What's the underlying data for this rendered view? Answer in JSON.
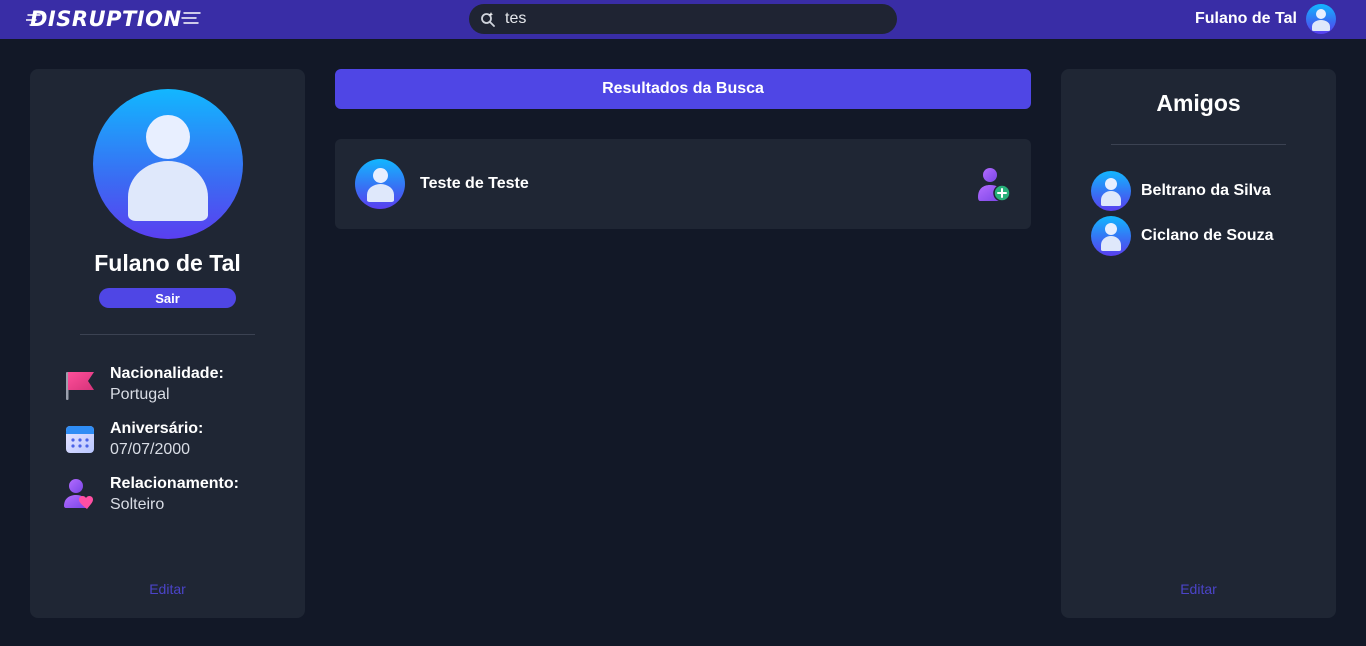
{
  "header": {
    "logo": "DISRUPTION",
    "search": {
      "value": "tes",
      "icon": "search-icon"
    },
    "user_name": "Fulano de Tal"
  },
  "profile": {
    "name": "Fulano de Tal",
    "logout_label": "Sair",
    "info": [
      {
        "label": "Nacionalidade:",
        "value": "Portugal",
        "icon": "flag-icon"
      },
      {
        "label": "Aniversário:",
        "value": "07/07/2000",
        "icon": "calendar-icon"
      },
      {
        "label": "Relacionamento:",
        "value": "Solteiro",
        "icon": "heart-user-icon"
      }
    ],
    "edit_label": "Editar"
  },
  "search_results": {
    "title": "Resultados da Busca",
    "items": [
      {
        "name": "Teste de Teste"
      }
    ]
  },
  "friends": {
    "title": "Amigos",
    "items": [
      {
        "name": "Beltrano da Silva"
      },
      {
        "name": "Ciclano de Souza"
      }
    ],
    "edit_label": "Editar"
  },
  "colors": {
    "topbar": "#392da6",
    "background": "#121827",
    "panel": "#1f2634",
    "accent": "#4f46e5",
    "edit_link": "#4b44c8"
  }
}
